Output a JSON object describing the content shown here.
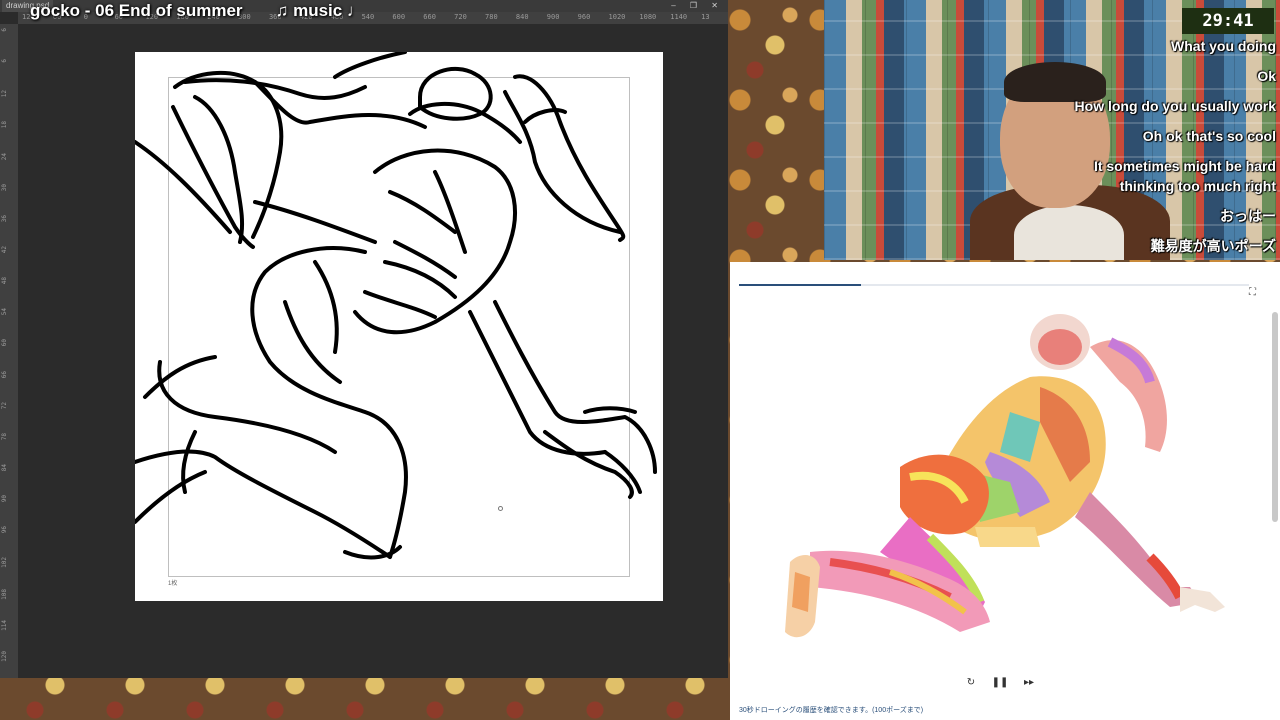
{
  "app": {
    "tab_label": "drawing.psd",
    "window_controls": "– ❐ ✕",
    "ruler_top": [
      "120",
      "60",
      "0",
      "60",
      "120",
      "180",
      "240",
      "300",
      "360",
      "420",
      "480",
      "540",
      "600",
      "660",
      "720",
      "780",
      "840",
      "900",
      "960",
      "1020",
      "1080",
      "1140",
      "13"
    ],
    "ruler_left": [
      "6",
      "6",
      "12",
      "18",
      "24",
      "30",
      "36",
      "42",
      "48",
      "54",
      "60",
      "66",
      "72",
      "78",
      "84",
      "90",
      "96",
      "102",
      "108",
      "114",
      "120"
    ],
    "frame_label": "1枚"
  },
  "overlay": {
    "now_playing": "gocko - 06 End of summer       ♫ music ♩"
  },
  "stream": {
    "timer": "29:41",
    "chat": [
      "What you doing",
      "Ok",
      "How long do you usually work",
      "Oh ok that's so cool",
      "It sometimes might be hard",
      "thinking too much right",
      "おっはー",
      "難易度が高いポーズ"
    ]
  },
  "viewer": {
    "progress": 0.24,
    "fullscreen_icon": "⛶",
    "controls": {
      "reset_icon": "↻",
      "pause_icon": "❚❚",
      "next_icon": "▸▸"
    },
    "footnote": "30秒ドローイングの履歴を確認できます。(100ポーズまで)"
  },
  "colors": {
    "accent": "#2a4f7a",
    "timer_bg": "#1e2f12"
  }
}
